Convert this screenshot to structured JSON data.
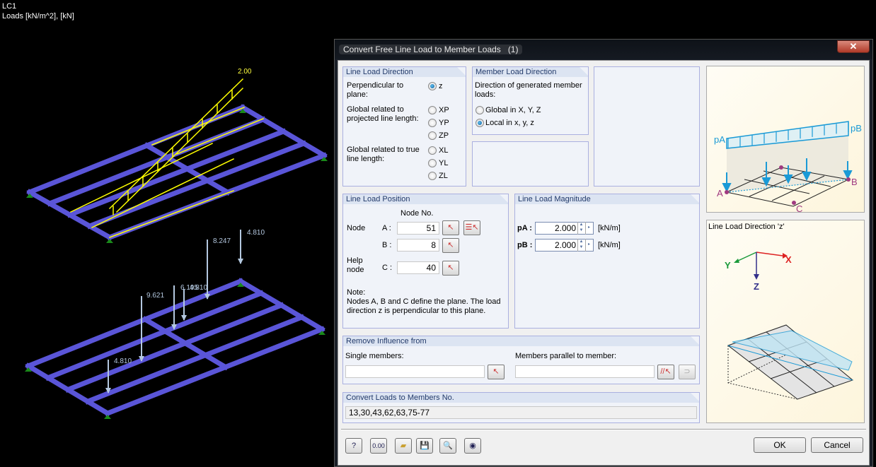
{
  "viewport": {
    "load_case": "LC1",
    "units_label": "Loads [kN/m^2], [kN]",
    "free_line_load_value": "2.00",
    "member_load_values": [
      "8.247",
      "4.810",
      "9.621",
      "6.195",
      "4.810",
      "4.810"
    ],
    "colors": {
      "beam": "#5a55d8",
      "selection": "#ffff00",
      "load_arrow": "#b4c8e0",
      "support": "#1a8a1a"
    }
  },
  "dialog": {
    "title": "Convert Free Line Load to Member Loads",
    "title_count": "(1)",
    "close_icon": "close-x-icon",
    "line_load_direction": {
      "header": "Line Load Direction",
      "perpendicular_label": "Perpendicular to plane:",
      "projected_label": "Global related to projected line length:",
      "true_length_label": "Global related to true line length:",
      "options": [
        {
          "label": "z",
          "selected": true
        },
        {
          "label": "XP",
          "selected": false
        },
        {
          "label": "YP",
          "selected": false
        },
        {
          "label": "ZP",
          "selected": false
        },
        {
          "label": "XL",
          "selected": false
        },
        {
          "label": "YL",
          "selected": false
        },
        {
          "label": "ZL",
          "selected": false
        }
      ]
    },
    "member_load_direction": {
      "header": "Member Load Direction",
      "description": "Direction of generated member loads:",
      "options": [
        {
          "label": "Global in X, Y, Z",
          "selected": false
        },
        {
          "label": "Local in x, y, z",
          "selected": true
        }
      ]
    },
    "line_load_position": {
      "header": "Line Load Position",
      "column_header": "Node No.",
      "node_label": "Node",
      "help_node_label": "Help node",
      "node_a_label": "A :",
      "node_a_value": "51",
      "node_b_label": "B :",
      "node_b_value": "8",
      "node_c_label": "C :",
      "node_c_value": "40",
      "note_title": "Note:",
      "note_text": "Nodes A, B and C define the plane. The load direction z is perpendicular to this plane."
    },
    "line_load_magnitude": {
      "header": "Line Load Magnitude",
      "pa_label": "pA :",
      "pa_value": "2.000",
      "pb_label": "pB :",
      "pb_value": "2.000",
      "unit": "[kN/m]"
    },
    "remove_influence": {
      "header": "Remove Influence from",
      "single_members_label": "Single members:",
      "single_members_value": "",
      "parallel_label": "Members parallel to member:",
      "parallel_value": ""
    },
    "convert_loads": {
      "header": "Convert Loads to Members No.",
      "value": "13,30,43,62,63,75-77"
    },
    "pictures": {
      "top": {
        "pA": "pA",
        "pB": "pB",
        "A": "A",
        "B": "B",
        "C": "C"
      },
      "bottom": {
        "title": "Line Load Direction 'z'",
        "X": "X",
        "Y": "Y",
        "Z": "Z"
      }
    },
    "footer": {
      "icon_buttons": [
        "help-icon",
        "units-icon",
        "open-icon",
        "save-icon",
        "search-icon",
        "view-icon"
      ],
      "units_icon_text": "0.00",
      "ok_label": "OK",
      "cancel_label": "Cancel"
    }
  }
}
